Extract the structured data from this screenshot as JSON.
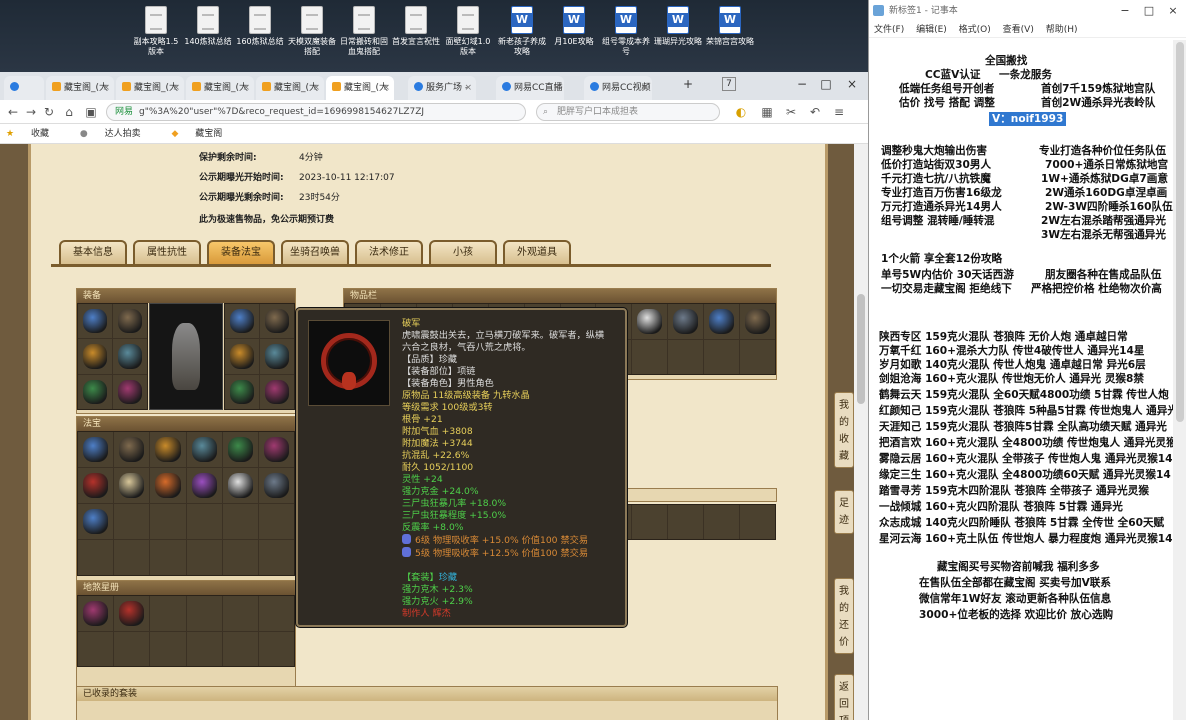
{
  "desktop_icons": [
    "副本攻略1.5版本",
    "140炼狱总结",
    "160炼狱总结",
    "天模双魔装备搭配",
    "日常搬砖和固血鬼搭配",
    "首发宣言祝性",
    "面壁幻域1.0版本",
    "新老孩子养成攻略",
    "月10E攻略",
    "组号零成本养号",
    "珊瑚异光攻略",
    "荣锦宫宫攻略"
  ],
  "browser": {
    "tabs": [
      {
        "label": "藏宝阁_(大"
      },
      {
        "label": "藏宝阁_(大"
      },
      {
        "label": "藏宝阁_(大"
      },
      {
        "label": "藏宝阁_(大"
      },
      {
        "label": "藏宝阁_(大"
      },
      {
        "label": "服务广场 -"
      },
      {
        "label": "网易CC直播"
      },
      {
        "label": "网易CC视频"
      }
    ],
    "new_tab": "+",
    "tab_count": "7",
    "address_site": "网易",
    "address_url": "g\"%3A%20\"user\"%7D&reco_request_id=1696998154627LZ7ZJ",
    "search_placeholder": "肥胖写户口本成担表",
    "bookmarks": [
      "收藏",
      "达人拍卖",
      "藏宝阁"
    ]
  },
  "game": {
    "info": [
      {
        "label": "保护剩余时间:",
        "value": "4分钟"
      },
      {
        "label": "公示期曝光开始时间:",
        "value": "2023-10-11 12:17:07"
      },
      {
        "label": "公示期曝光剩余时间:",
        "value": "23时54分"
      },
      {
        "label": "此为极速售物品，免公示期预订费",
        "value": ""
      }
    ],
    "tabs": [
      "基本信息",
      "属性抗性",
      "装备法宝",
      "坐骑召唤兽",
      "法术修正",
      "小孩",
      "外观道具"
    ],
    "sections": {
      "equip": "装备",
      "fabao": "法宝",
      "dizang": "地煞星册",
      "bag": "物品栏",
      "collected": "已收录的套装"
    },
    "side_buttons": [
      "我的收藏",
      "足迹",
      "我的还价",
      "返回顶部"
    ],
    "tooltip": {
      "name": "破军",
      "desc1": "虎啸震鼓出关去，立马横刀破军来。破军者，纵横",
      "desc2": "六合之良材，气吞八荒之虎将。",
      "lines": [
        {
          "t": "【品质】珍藏",
          "c": "w"
        },
        {
          "t": "【装备部位】项链",
          "c": "w"
        },
        {
          "t": "【装备角色】男性角色",
          "c": "w"
        },
        {
          "t": "原物品 11级高级装备 九转水晶",
          "c": "y"
        },
        {
          "t": "等级需求 100级或3转",
          "c": "y"
        },
        {
          "t": "根骨 +21",
          "c": "y"
        },
        {
          "t": "附加气血 +3808",
          "c": "y"
        },
        {
          "t": "附加魔法 +3744",
          "c": "y"
        },
        {
          "t": "抗混乱 +22.6%",
          "c": "y"
        },
        {
          "t": "耐久 1052/1100",
          "c": "y"
        },
        {
          "t": "灵性 +24",
          "c": "g"
        },
        {
          "t": "强力克金 +24.0%",
          "c": "g"
        },
        {
          "t": "三尸虫狂暴几率 +18.0%",
          "c": "g"
        },
        {
          "t": "三尸虫狂暴程度 +15.0%",
          "c": "g"
        },
        {
          "t": "反震率 +8.0%",
          "c": "g"
        }
      ],
      "gems": [
        {
          "t": "6级 物理吸收率 +15.0% 价值100 禁交易"
        },
        {
          "t": "5级 物理吸收率 +12.5% 价值100 禁交易"
        }
      ],
      "set_label": "【套装】",
      "set_value": "珍藏",
      "set_lines": [
        "强力克木 +2.3%",
        "强力克火 +2.9%"
      ],
      "maker": "制作人 辉杰"
    }
  },
  "notepad": {
    "title": "新标签1 - 记事本",
    "menu": [
      "文件(F)",
      "编辑(E)",
      "格式(O)",
      "查看(V)",
      "帮助(H)"
    ],
    "lines": [
      {
        "t": "全国搬找"
      },
      {
        "t": "CC蓝V认证"
      },
      {
        "t": "一条龙服务"
      },
      {
        "t": "低端任务组号开创者"
      },
      {
        "t": "首创7千159炼狱地宫队"
      },
      {
        "t": "估价 找号 搭配 调整"
      },
      {
        "t": "首创2W通杀异光表岭队"
      },
      {
        "t": "V：noif1993"
      },
      {
        "t": "调整秒鬼大炮输出伤害"
      },
      {
        "t": "专业打造各种价位任务队伍"
      },
      {
        "t": "低价打造站街双30男人"
      },
      {
        "t": "7000+通杀日常炼狱地宫"
      },
      {
        "t": "千元打造七抗/八抗铁魔"
      },
      {
        "t": "1W+通杀炼狱DG卓7画意"
      },
      {
        "t": "专业打造百万伤害16级龙"
      },
      {
        "t": "2W通杀160DG卓涅卓画"
      },
      {
        "t": "万元打造通杀异光14男人"
      },
      {
        "t": "2W-3W四阶睡杀160队伍"
      },
      {
        "t": "组号调整 混转睡/睡转混"
      },
      {
        "t": "2W左右混杀踏帮强通异光"
      },
      {
        "t": "3W左右混杀无帮强通异光"
      },
      {
        "t": "1个火箭 享全套12份攻略"
      },
      {
        "t": "单号5W内估价 30天话西游"
      },
      {
        "t": "朋友圈各种在售成品队伍"
      },
      {
        "t": "一切交易走藏宝阁 拒绝线下"
      },
      {
        "t": "严格把控价格 杜绝物次价高"
      },
      {
        "t": "陕西专区 159克火混队 苍狼阵 无价人炮 通卓越日常"
      },
      {
        "t": "万氧千红 160+混杀大力队 传世4破传世人 通异光14星"
      },
      {
        "t": "岁月如歌 140克火混队 传世人炮鬼 通卓越日常 异光6层"
      },
      {
        "t": "剑姐沧海 160+克火混队 传世炮无价人 通异光 灵猴8禁"
      },
      {
        "t": "鹤舞云天 159克火混队 全60天赋4800功绩 5甘霖 传世人炮"
      },
      {
        "t": "红颜知己 159克火混队 苍狼阵 5种晶5甘霖 传世炮鬼人 通异光"
      },
      {
        "t": "天涯知己 159克火混队 苍狼阵5甘霖 全队高功绩天赋 通异光"
      },
      {
        "t": "把酒言欢 160+克火混队 全4800功绩 传世炮鬼人 通异光灵猴"
      },
      {
        "t": "雾隐云居 160+克火混队 全带孩子 传世炮人鬼 通异光灵猴14"
      },
      {
        "t": "缘定三生 160+克火混队 全4800功绩60天赋 通异光灵猴14"
      },
      {
        "t": "踏雪寻芳 159克木四阶混队 苍狼阵 全带孩子 通异光灵猴"
      },
      {
        "t": "一战倾城 160+克火四阶混队 苍狼阵 5甘霖 通异光"
      },
      {
        "t": "众志成城 140克火四阶睡队 苍狼阵 5甘霖 全传世 全60天赋"
      },
      {
        "t": "星河云海 160+克土队伍 传世炮人 暴力程度炮 通异光灵猴14"
      },
      {
        "t": "藏宝阁买号买物咨前喊我 福利多多"
      },
      {
        "t": "在售队伍全部都在藏宝阁 买卖号加V联系"
      },
      {
        "t": "微信常年1W好友 滚动更新各种队伍信息"
      },
      {
        "t": "3000+位老板的选择 欢迎比价 放心选购"
      }
    ]
  }
}
